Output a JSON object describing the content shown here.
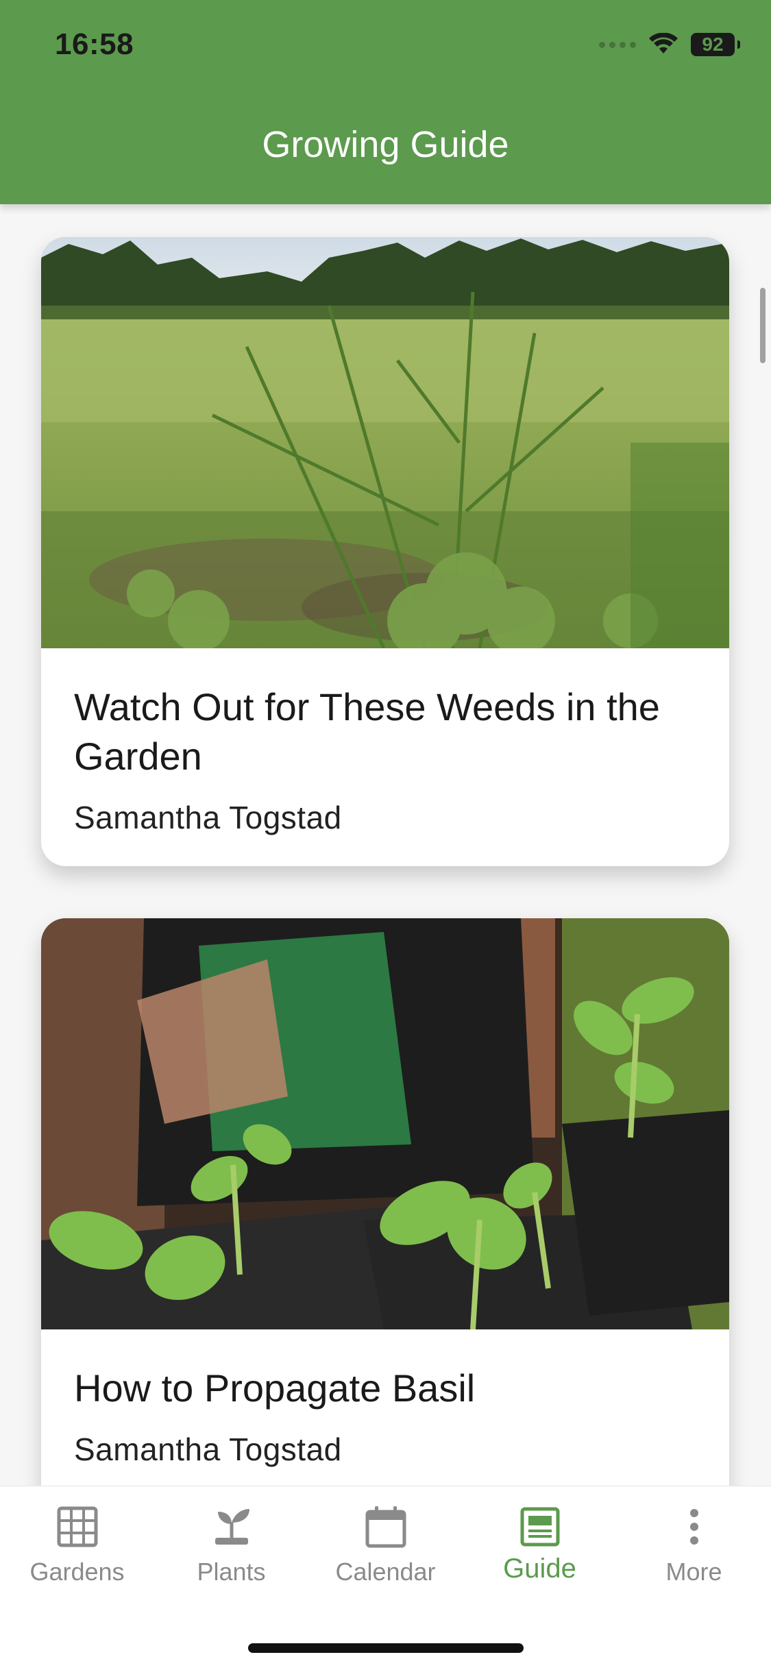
{
  "status_bar": {
    "time": "16:58",
    "battery": "92"
  },
  "header": {
    "title": "Growing Guide"
  },
  "articles": [
    {
      "title": "Watch Out for These Weeds in the Garden",
      "author": "Samantha Togstad",
      "image": "weedy-field-photo"
    },
    {
      "title": "How to Propagate Basil",
      "author": "Samantha Togstad",
      "image": "basil-seedlings-photo"
    }
  ],
  "tabs": [
    {
      "label": "Gardens",
      "icon": "grid-icon",
      "active": false
    },
    {
      "label": "Plants",
      "icon": "sprout-icon",
      "active": false
    },
    {
      "label": "Calendar",
      "icon": "calendar-icon",
      "active": false
    },
    {
      "label": "Guide",
      "icon": "guide-icon",
      "active": true
    },
    {
      "label": "More",
      "icon": "more-vertical-icon",
      "active": false
    }
  ],
  "colors": {
    "brand_green": "#5c9a4e",
    "inactive_tab": "#8a8a8a"
  }
}
